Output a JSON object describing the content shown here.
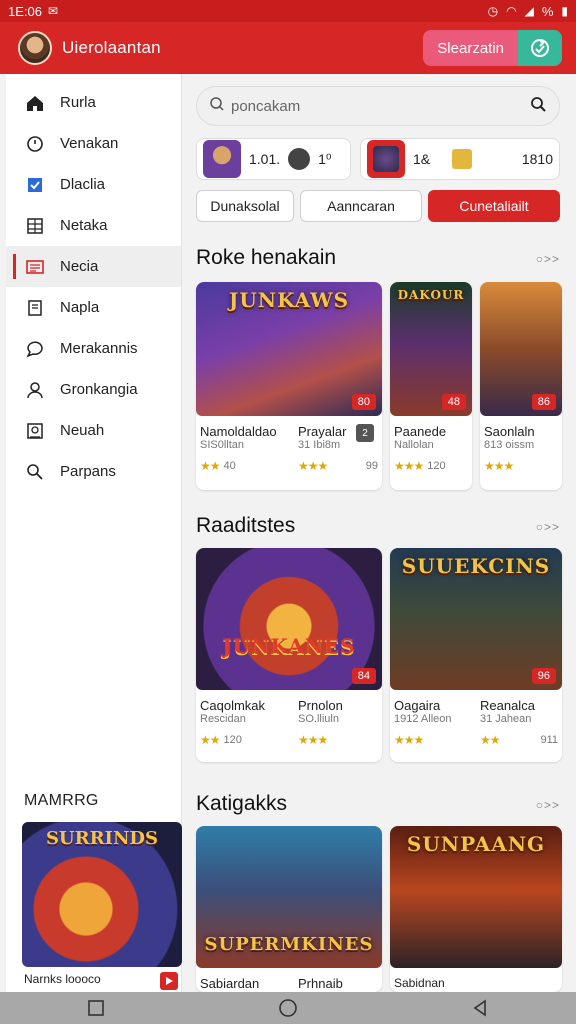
{
  "status": {
    "time": "1E:06",
    "battery": "%"
  },
  "appbar": {
    "title": "Uierolaantan",
    "action_label": "Slearzatin"
  },
  "sidebar": {
    "items": [
      {
        "label": "Rurla",
        "icon": "home-icon"
      },
      {
        "label": "Venakan",
        "icon": "clock-icon"
      },
      {
        "label": "Dlaclia",
        "icon": "check-icon"
      },
      {
        "label": "Netaka",
        "icon": "grid-icon"
      },
      {
        "label": "Necia",
        "icon": "news-icon",
        "active": true
      },
      {
        "label": "Napla",
        "icon": "bookmark-icon"
      },
      {
        "label": "Merakannis",
        "icon": "chat-icon"
      },
      {
        "label": "Gronkangia",
        "icon": "user-icon"
      },
      {
        "label": "Neuah",
        "icon": "box-icon"
      },
      {
        "label": "Parpans",
        "icon": "search-icon"
      }
    ],
    "section_title": "MAMRRG",
    "featured": {
      "caption": "Narnks loooco",
      "overlay": "SURRINDS"
    }
  },
  "search": {
    "placeholder": "poncakam"
  },
  "promo": [
    {
      "text": "1.01.",
      "sub": "1⁰"
    },
    {
      "text": "1&",
      "sub": "1810"
    }
  ],
  "tabs": [
    "Dunaksolal",
    "Aanncaran",
    "Cunetaliailt"
  ],
  "sections": [
    {
      "title": "Roke henakain",
      "more": "○>>",
      "cards": [
        {
          "title": "Namoldaldao",
          "sub": "SIS0lltan",
          "rating": "★★",
          "count": "40",
          "tag": "80",
          "overlay": "JUNKAWS"
        },
        {
          "title": "Prayalar",
          "sub": "31 Ibi8m",
          "rating": "★★★",
          "count": "99",
          "tag": "2",
          "overlay": ""
        },
        {
          "title": "Paanede",
          "sub": "Nallolan",
          "rating": "★★★",
          "count": "120",
          "tag": "48",
          "overlay": "DAKOUR"
        },
        {
          "title": "Saonlaln",
          "sub": "813 oissm",
          "rating": "★★★",
          "count": "",
          "tag": "86",
          "overlay": ""
        }
      ]
    },
    {
      "title": "Raaditstes",
      "more": "○>>",
      "cards": [
        {
          "title": "Caqolmkak",
          "sub": "Rescidan",
          "rating": "★★",
          "count": "120",
          "tag": "84",
          "overlay": "JUNKANES"
        },
        {
          "title": "Prnolon",
          "sub": "SO.lliuln",
          "rating": "★★★",
          "count": "",
          "tag": "",
          "overlay": ""
        },
        {
          "title": "Oagaira",
          "sub": "1912 Alleon",
          "rating": "★★★",
          "count": "",
          "tag": "96",
          "overlay": "SUUEKCINS"
        },
        {
          "title": "Reanalca",
          "sub": "31 Jahean",
          "rating": "★★",
          "count": "911",
          "tag": "",
          "overlay": ""
        }
      ]
    },
    {
      "title": "Katigakks",
      "more": "○>>",
      "cards": [
        {
          "title": "Sabiardan",
          "sub": "",
          "overlay": "SUPERMKINES",
          "footer": "Prhnaib"
        },
        {
          "title": "Sabidnan",
          "sub": "",
          "overlay": "SUNPAANG",
          "footer": ""
        }
      ]
    }
  ]
}
